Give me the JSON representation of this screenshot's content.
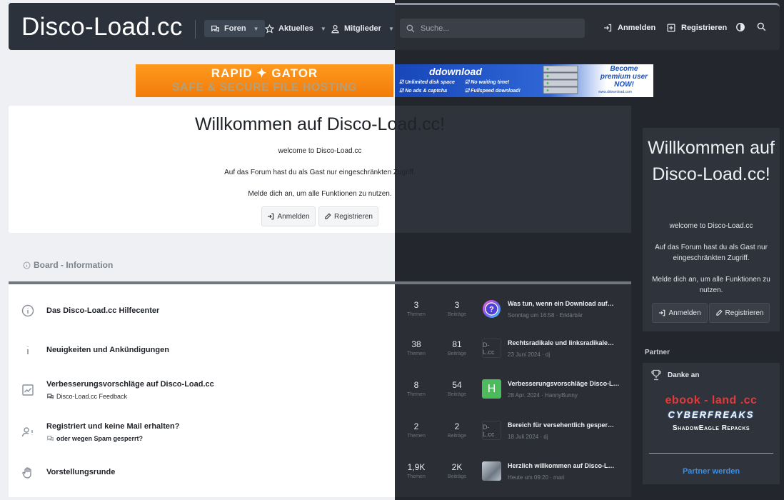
{
  "header": {
    "brand": "Disco-Load.cc",
    "nav": [
      {
        "label": "Foren",
        "icon": "comments-icon"
      },
      {
        "label": "Aktuelles",
        "icon": "star-icon"
      },
      {
        "label": "Mitglieder",
        "icon": "user-icon"
      }
    ],
    "search_placeholder": "Suche...",
    "login_label": "Anmelden",
    "register_label": "Registrieren"
  },
  "banners": {
    "rapidgator": {
      "line1": "RAPID ✦ GATOR",
      "line2": "SAFE & SECURE FILE HOSTING"
    },
    "ddownload": {
      "logo": "ddownload",
      "features": [
        "Unlimited disk space",
        "No waiting time!",
        "No ads & captcha",
        "Fullspeed download!"
      ],
      "cta": "Become premium user NOW!",
      "url": "www.ddownload.com"
    }
  },
  "welcome": {
    "title": "Willkommen auf Disco-Load.cc!",
    "subtitle": "welcome to Disco-Load.cc",
    "line1": "Auf das Forum hast du als Gast nur eingeschränkten Zugriff.",
    "line2": "Melde dich an, um alle Funktionen zu nutzen.",
    "login": "Anmelden",
    "register": "Registrieren"
  },
  "board": {
    "heading": "Board - Information",
    "threads_label": "Themen",
    "posts_label": "Beiträge",
    "forums": [
      {
        "title": "Das Disco-Load.cc Hilfecenter",
        "sub": "",
        "icon": "info-circle-icon",
        "threads": "3",
        "posts": "3",
        "lp_title": "Was tun, wenn ein Download auf…",
        "lp_meta": "Sonntag um 16:58 · Erklärbär",
        "avatar": "?",
        "avatar_color": "#7b5cf0"
      },
      {
        "title": "Neuigkeiten und Ankündigungen",
        "sub": "",
        "icon": "info-icon",
        "threads": "38",
        "posts": "81",
        "lp_title": "Rechtsradikale und linksradikale…",
        "lp_meta": "23 Juni 2024 · dj",
        "avatar": "D-L.cc",
        "avatar_color": "#2b2e35"
      },
      {
        "title": "Verbesserungsvorschläge auf Disco-Load.cc",
        "sub": "Disco-Load.cc Feedback",
        "icon": "chart-icon",
        "threads": "8",
        "posts": "54",
        "lp_title": "Verbesserungsvorschläge Disco-L…",
        "lp_meta": "28 Apr. 2024 · HannyBunny",
        "avatar": "H",
        "avatar_color": "#4cbb5b"
      },
      {
        "title": "Registriert und keine Mail erhalten?",
        "sub": "oder wegen Spam gesperrt?",
        "icon": "user-alert-icon",
        "threads": "2",
        "posts": "2",
        "lp_title": "Bereich für versehentlich gesper…",
        "lp_meta": "18 Juli 2024 · dj",
        "avatar": "D-L.cc",
        "avatar_color": "#2b2e35"
      },
      {
        "title": "Vorstellungsrunde",
        "sub": "",
        "icon": "hand-icon",
        "threads": "1,9K",
        "posts": "2K",
        "lp_title": "Herzlich willkommen auf Disco-L…",
        "lp_meta": "Heute um 09:20 · mari",
        "avatar": "",
        "avatar_color": "#8e9aa6"
      }
    ]
  },
  "sidebar": {
    "title": "Willkommen auf Disco-Load.cc!",
    "subtitle": "welcome to Disco-Load.cc",
    "line1": "Auf das Forum hast du als Gast nur eingeschränkten Zugriff.",
    "line2": "Melde dich an, um alle Funktionen zu nutzen.",
    "login": "Anmelden",
    "register": "Registrieren",
    "partner_heading": "Partner",
    "thanks": "Danke an",
    "partners": [
      "ebook - land .cc",
      "CYBERFREAKS",
      "ShadowEagle Repacks"
    ],
    "partner_link": "Partner werden"
  }
}
